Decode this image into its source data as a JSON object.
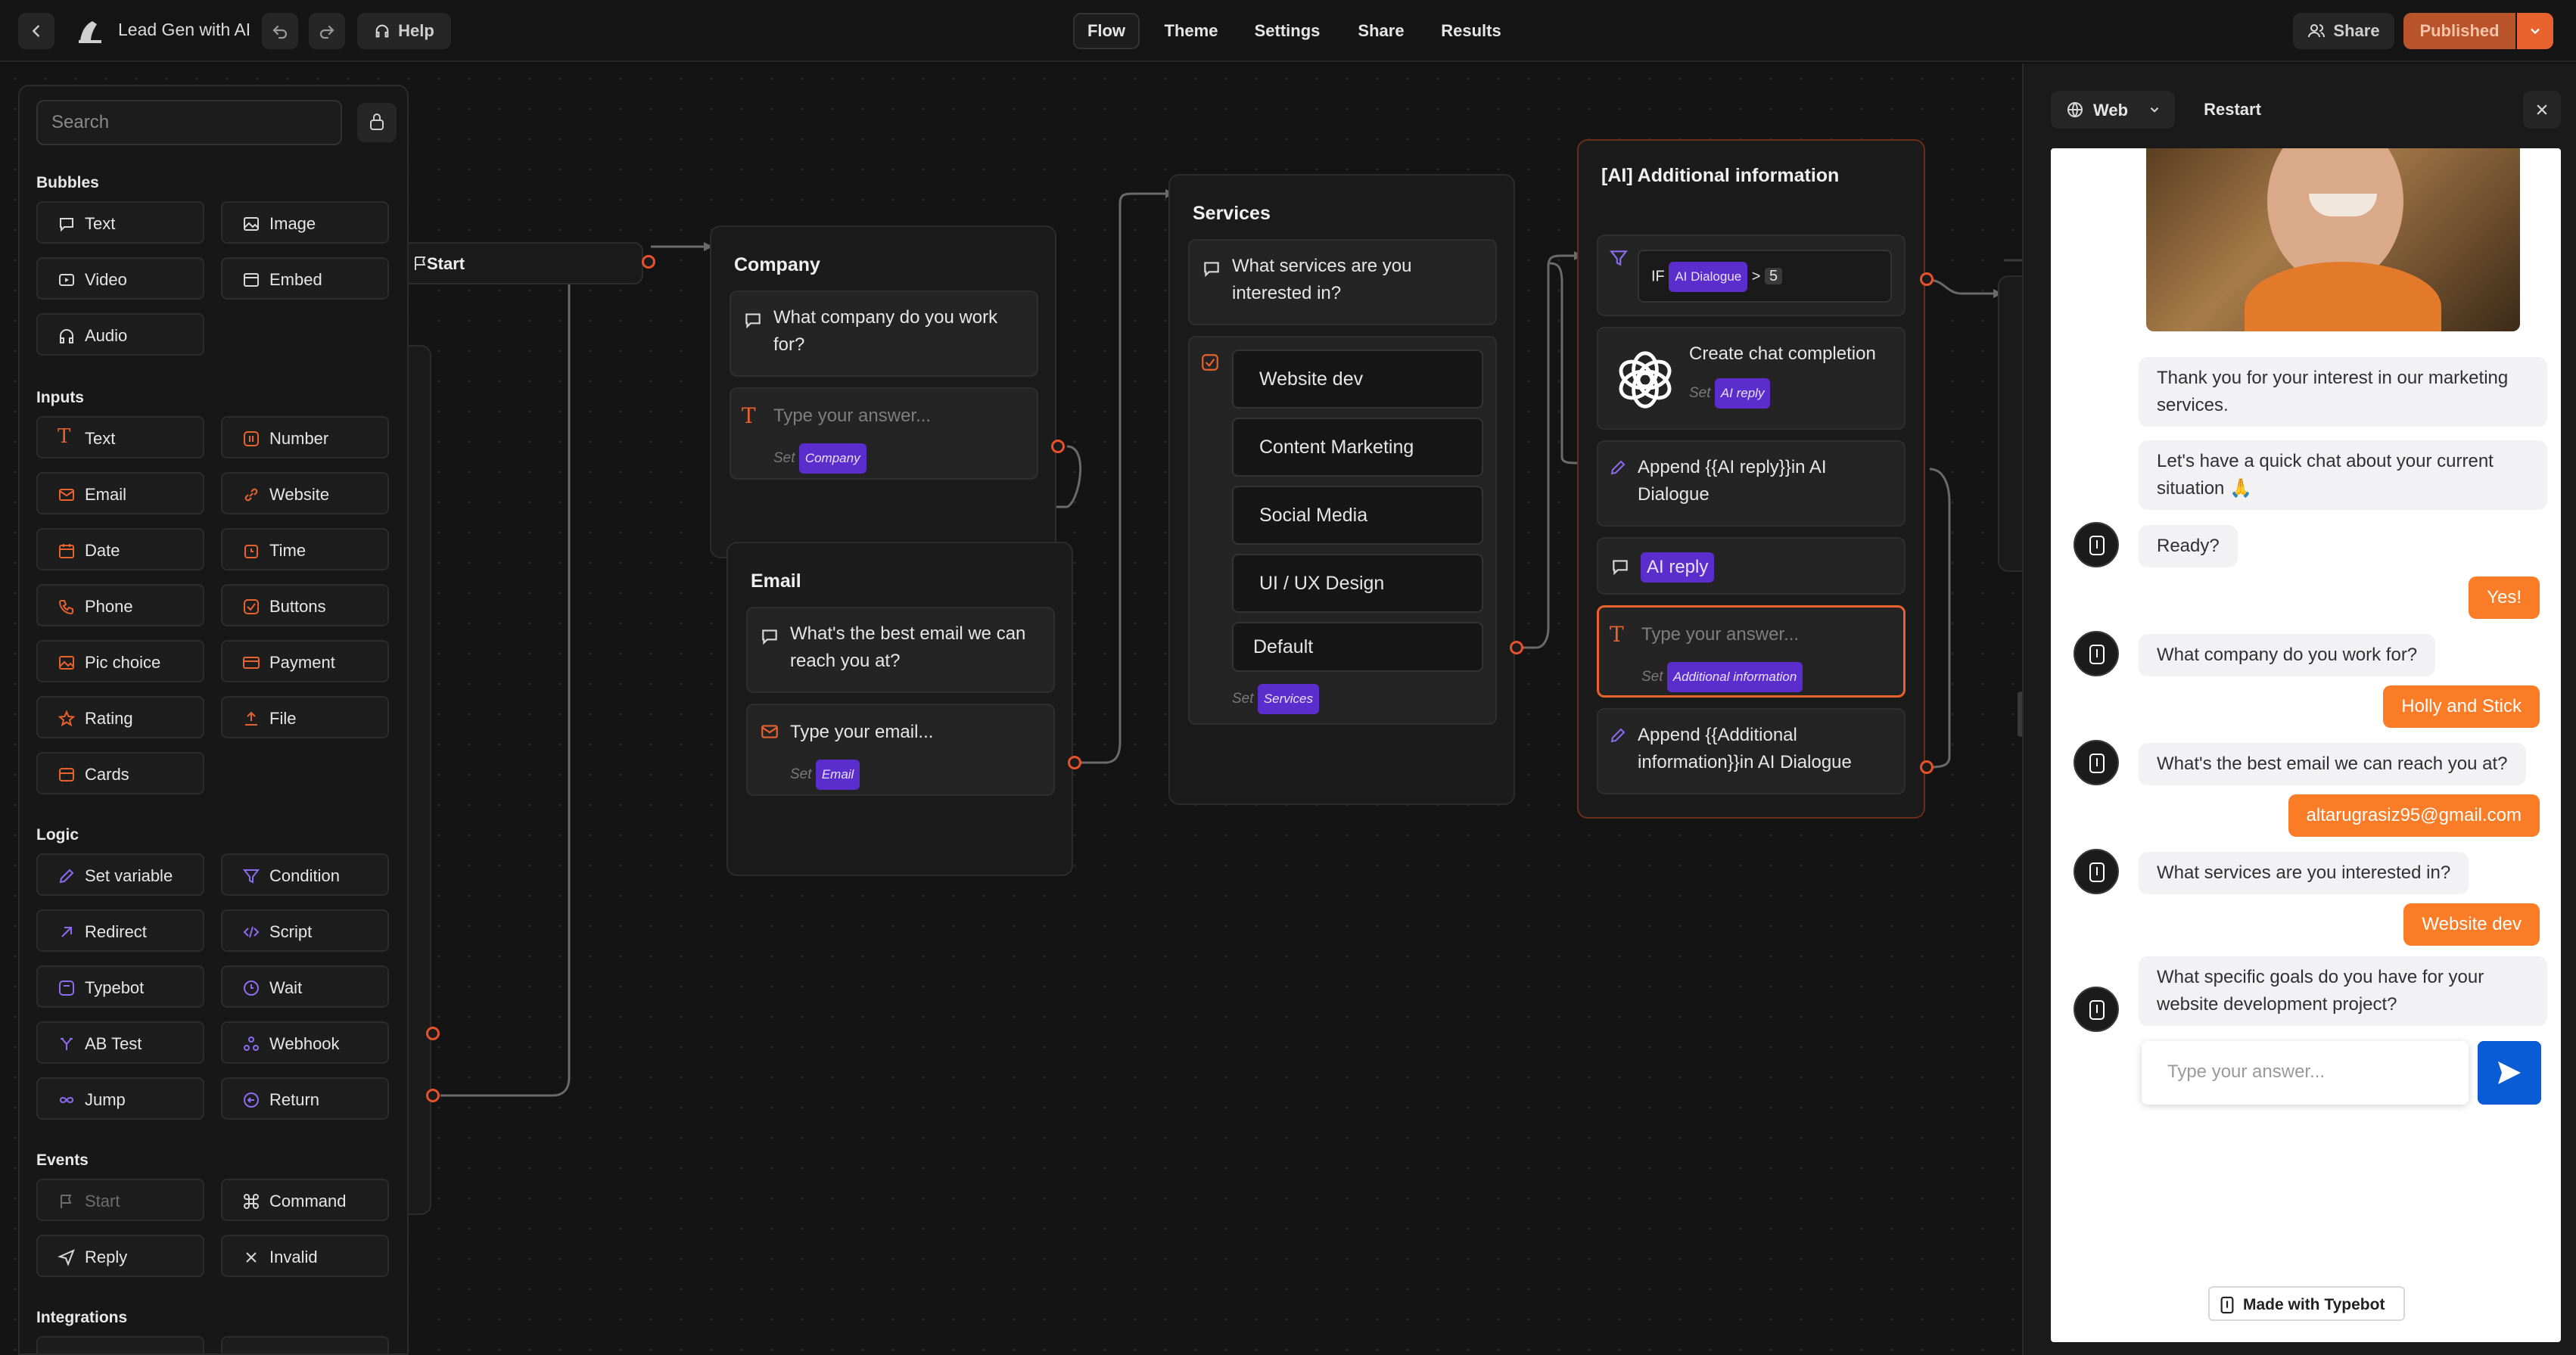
{
  "app": {
    "title": "Lead Gen with AI",
    "help_label": "Help",
    "nav_tabs": [
      "Flow",
      "Theme",
      "Settings",
      "Share",
      "Results"
    ],
    "active_tab": "Flow",
    "share_label": "Share",
    "published_label": "Published",
    "accent_color": "#e8622e"
  },
  "sidebar": {
    "search_placeholder": "Search",
    "sections": {
      "bubbles": {
        "title": "Bubbles",
        "items": [
          "Text",
          "Image",
          "Video",
          "Embed",
          "Audio"
        ]
      },
      "inputs": {
        "title": "Inputs",
        "items": [
          "Text",
          "Number",
          "Email",
          "Website",
          "Date",
          "Time",
          "Phone",
          "Buttons",
          "Pic choice",
          "Payment",
          "Rating",
          "File",
          "Cards"
        ]
      },
      "logic": {
        "title": "Logic",
        "items": [
          "Set variable",
          "Condition",
          "Redirect",
          "Script",
          "Typebot",
          "Wait",
          "AB Test",
          "Webhook",
          "Jump",
          "Return"
        ]
      },
      "events": {
        "title": "Events",
        "items": [
          "Start",
          "Command",
          "Reply",
          "Invalid"
        ]
      },
      "integrations": {
        "title": "Integrations"
      }
    }
  },
  "canvas": {
    "start": {
      "label": "Start"
    },
    "company": {
      "title": "Company",
      "text": "What company do you work for?",
      "input_placeholder": "Type your answer...",
      "set_label": "Set",
      "variable": "Company"
    },
    "email": {
      "title": "Email",
      "text": "What's the best email we can reach you at?",
      "input_placeholder": "Type your email...",
      "set_label": "Set",
      "variable": "Email"
    },
    "services": {
      "title": "Services",
      "text": "What services are you interested in?",
      "choices": [
        "Website dev",
        "Content Marketing",
        "Social Media",
        "UI / UX Design"
      ],
      "default_label": "Default",
      "set_label": "Set",
      "variable": "Services"
    },
    "ai": {
      "title": "[AI] Additional information",
      "condition_if": "IF",
      "condition_var": "AI Dialogue",
      "condition_op": ">",
      "condition_value": "5",
      "openai_label": "Create chat completion",
      "openai_set": "Set",
      "openai_var": "AI reply",
      "append1": "Append {{AI reply}}in AI Dialogue",
      "bubble_var": "AI reply",
      "input_placeholder": "Type your answer...",
      "input_set": "Set",
      "input_var": "Additional information",
      "append2": "Append {{Additional information}}in AI Dialogue"
    }
  },
  "preview": {
    "mode_label": "Web",
    "restart_label": "Restart",
    "messages": [
      {
        "from": "bot",
        "text": "Thank you for your interest in our marketing services."
      },
      {
        "from": "bot",
        "text": "Let's have a quick chat about your current situation 🙏"
      },
      {
        "from": "bot",
        "text": "Ready?"
      },
      {
        "from": "user",
        "text": "Yes!"
      },
      {
        "from": "bot",
        "text": "What company do you work for?"
      },
      {
        "from": "user",
        "text": "Holly and Stick"
      },
      {
        "from": "bot",
        "text": "What's the best email we can reach you at?"
      },
      {
        "from": "user",
        "text": "altarugrasiz95@gmail.com"
      },
      {
        "from": "bot",
        "text": "What services are you interested in?"
      },
      {
        "from": "user",
        "text": "Website dev"
      },
      {
        "from": "bot",
        "text": "What specific goals do you have for your website development project?"
      }
    ],
    "input_placeholder": "Type your answer...",
    "footer": "Made with Typebot",
    "send_color": "#0a5bd6"
  }
}
